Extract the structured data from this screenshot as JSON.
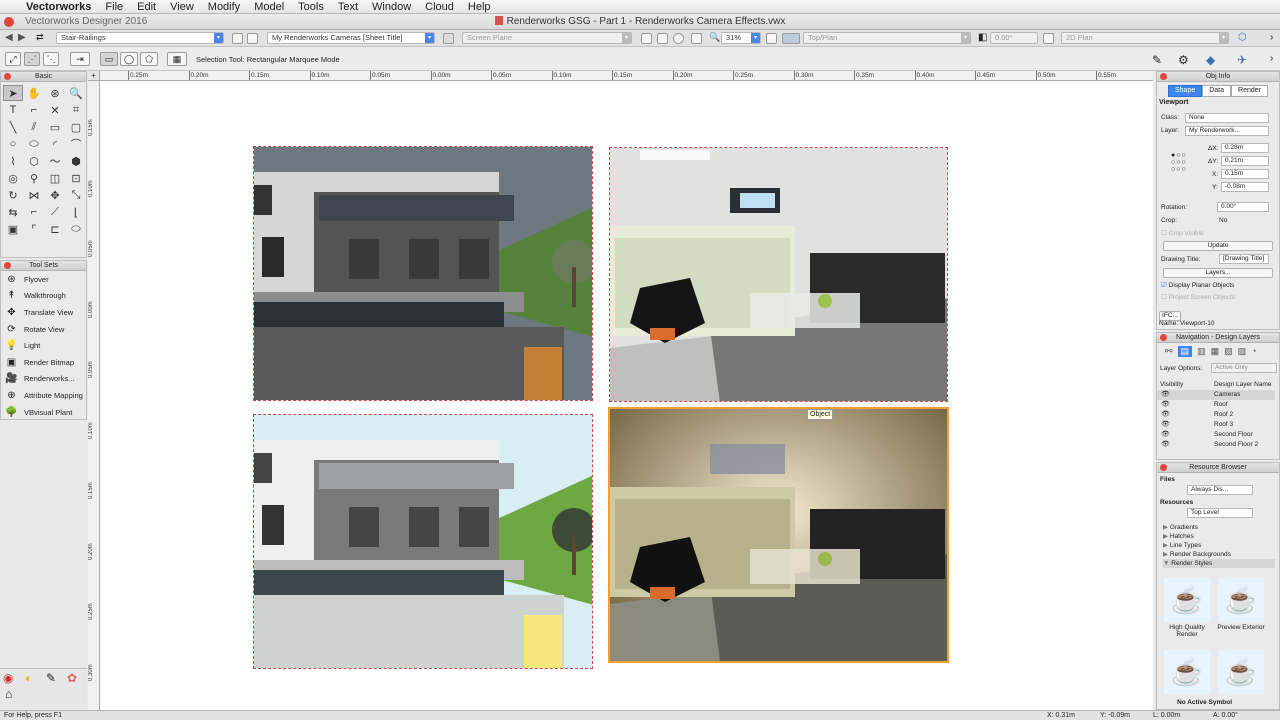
{
  "menubar": {
    "apple": "",
    "app": "Vectorworks",
    "items": [
      "File",
      "Edit",
      "View",
      "Modify",
      "Model",
      "Tools",
      "Text",
      "Window",
      "Cloud",
      "Help"
    ]
  },
  "window": {
    "app_version": "Vectorworks Designer 2016",
    "title": "Renderworks GSG - Part 1 - Renderworks Camera Effects.vwx"
  },
  "viewbar": {
    "class_combo": "Stair-Railings",
    "layer_combo": "My Renderworks Cameras [Sheet Title]",
    "plane_combo": "Screen Plane",
    "zoom": "31%",
    "view_combo": "Top/Plan",
    "rotation": "0.00°",
    "render_combo": "2D Plan"
  },
  "toolbar2": {
    "status": "Selection Tool: Rectangular Marquee Mode"
  },
  "basic_palette": {
    "title": "Basic",
    "tools": [
      "arrow",
      "pan",
      "flyover",
      "zoom",
      "text",
      "callout",
      "locus",
      "clip",
      "line",
      "dbl-line",
      "rect",
      "round-rect",
      "circle",
      "oval",
      "arc",
      "quarter-arc",
      "polyline",
      "polygon",
      "freehand",
      "reg-polygon",
      "spiral",
      "eyedrop",
      "attributes",
      "reshape",
      "rotate",
      "mirror",
      "move",
      "scale",
      "offset",
      "connect",
      "split",
      "fillet",
      "vp-crop",
      "trim",
      "dim",
      "object"
    ]
  },
  "toolsets": {
    "title": "Tool Sets",
    "items": [
      {
        "label": "Flyover",
        "icon": "flyover-icon"
      },
      {
        "label": "Walkthrough",
        "icon": "walkthrough-icon"
      },
      {
        "label": "Translate View",
        "icon": "translate-view-icon"
      },
      {
        "label": "Rotate View",
        "icon": "rotate-view-icon"
      },
      {
        "label": "Light",
        "icon": "light-icon"
      },
      {
        "label": "Render Bitmap",
        "icon": "render-bitmap-icon"
      },
      {
        "label": "Renderworks...",
        "icon": "renderworks-camera-icon"
      },
      {
        "label": "Attribute Mapping",
        "icon": "attribute-mapping-icon"
      },
      {
        "label": "VBvisual Plant",
        "icon": "plant-icon"
      }
    ]
  },
  "ruler_h": [
    "0.25m",
    "0.20m",
    "0.15m",
    "0.10m",
    "0.05m",
    "0.00m",
    "0.05m",
    "0.10m",
    "0.15m",
    "0.20m",
    "0.25m",
    "0.30m",
    "0.35m",
    "0.40m",
    "0.45m",
    "0.50m",
    "0.55m"
  ],
  "ruler_v": [
    "0.15m",
    "0.10m",
    "0.05m",
    "0.00m",
    "0.05m",
    "0.10m",
    "0.15m",
    "0.20m",
    "0.25m",
    "0.30m"
  ],
  "canvas": {
    "object_label": "Object"
  },
  "obj_info": {
    "title": "Obj Info",
    "tabs": [
      "Shape",
      "Data",
      "Render"
    ],
    "type": "Viewport",
    "class_label": "Class:",
    "class_value": "None",
    "layer_label": "Layer:",
    "layer_value": "My Renderwork...",
    "dx_label": "ΔX:",
    "dx": "0.28m",
    "dy_label": "ΔY:",
    "dy": "0.21m",
    "x_label": "X:",
    "x": "0.15m",
    "y_label": "Y:",
    "y": "-0.08m",
    "rotation_label": "Rotation:",
    "rotation": "0.00°",
    "crop_label": "Crop:",
    "crop": "No",
    "crop_visible": "Crop Visible",
    "update": "Update",
    "drawing_title_label": "Drawing Title:",
    "drawing_title": "[Drawing Title]",
    "layers_btn": "Layers...",
    "display_planar": "Display Planar Objects",
    "project_screen": "Project Screen Objects",
    "ifc": "IFC...",
    "name": "Name: Viewport-10"
  },
  "navigation": {
    "title": "Navigation - Design Layers",
    "layer_options_label": "Layer Options:",
    "layer_options": "Active Only",
    "col_visibility": "Visibility",
    "col_name": "Design Layer Name",
    "layers": [
      "Cameras",
      "Roof",
      "Roof 2",
      "Roof 3",
      "Second Floor",
      "Second Floor 2"
    ]
  },
  "resource_browser": {
    "title": "Resource Browser",
    "files_label": "Files",
    "files_value": "Always Dis...",
    "resources_label": "Resources",
    "resources_value": "Top Level",
    "tree": [
      "Gradients",
      "Hatches",
      "Line Types",
      "Render Backgrounds",
      "Render Styles"
    ],
    "thumbs": [
      "High Quality Render",
      "Preview Exterior",
      "",
      ""
    ],
    "footer": "No Active Symbol"
  },
  "statusbar": {
    "help": "For Help, press F1",
    "x": "X: 0.31m",
    "y": "Y: -0.09m",
    "l": "L: 0.00m",
    "a": "A: 0.00°"
  }
}
